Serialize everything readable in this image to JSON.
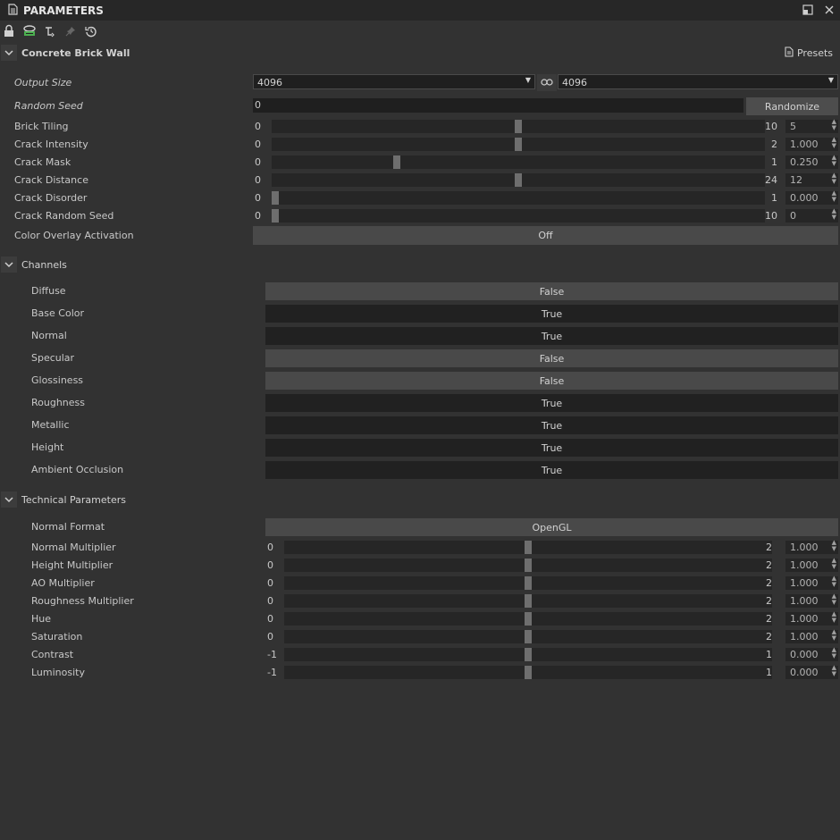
{
  "window": {
    "title": "PARAMETERS",
    "icons": [
      "document-icon",
      "float-window-icon",
      "close-icon"
    ]
  },
  "toolbar": {
    "icons": [
      "lock-icon",
      "refresh-icon",
      "hierarchy-icon",
      "pin-icon",
      "reset-icon"
    ]
  },
  "material": {
    "title": "Concrete Brick Wall",
    "presets_label": "Presets",
    "output_size": {
      "label": "Output Size",
      "width": "4096",
      "height": "4096"
    },
    "random_seed": {
      "label": "Random Seed",
      "value": "0",
      "button": "Randomize"
    },
    "sliders": [
      {
        "label": "Brick Tiling",
        "min": "0",
        "max": "10",
        "value": "5",
        "fraction": 0.5
      },
      {
        "label": "Crack Intensity",
        "min": "0",
        "max": "2",
        "value": "1.000",
        "fraction": 0.5
      },
      {
        "label": "Crack Mask",
        "min": "0",
        "max": "1",
        "value": "0.250",
        "fraction": 0.25
      },
      {
        "label": "Crack Distance",
        "min": "0",
        "max": "24",
        "value": "12",
        "fraction": 0.5
      },
      {
        "label": "Crack Disorder",
        "min": "0",
        "max": "1",
        "value": "0.000",
        "fraction": 0.0
      },
      {
        "label": "Crack Random Seed",
        "min": "0",
        "max": "10",
        "value": "0",
        "fraction": 0.0
      }
    ],
    "color_overlay": {
      "label": "Color Overlay Activation",
      "value": "Off"
    }
  },
  "channels": {
    "title": "Channels",
    "items": [
      {
        "label": "Diffuse",
        "value": "False"
      },
      {
        "label": "Base Color",
        "value": "True"
      },
      {
        "label": "Normal",
        "value": "True"
      },
      {
        "label": "Specular",
        "value": "False"
      },
      {
        "label": "Glossiness",
        "value": "False"
      },
      {
        "label": "Roughness",
        "value": "True"
      },
      {
        "label": "Metallic",
        "value": "True"
      },
      {
        "label": "Height",
        "value": "True"
      },
      {
        "label": "Ambient Occlusion",
        "value": "True"
      }
    ]
  },
  "technical": {
    "title": "Technical Parameters",
    "normal_format": {
      "label": "Normal Format",
      "value": "OpenGL"
    },
    "sliders": [
      {
        "label": "Normal Multiplier",
        "min": "0",
        "max": "2",
        "value": "1.000",
        "fraction": 0.5
      },
      {
        "label": "Height Multiplier",
        "min": "0",
        "max": "2",
        "value": "1.000",
        "fraction": 0.5
      },
      {
        "label": "AO Multiplier",
        "min": "0",
        "max": "2",
        "value": "1.000",
        "fraction": 0.5
      },
      {
        "label": "Roughness Multiplier",
        "min": "0",
        "max": "2",
        "value": "1.000",
        "fraction": 0.5
      },
      {
        "label": "Hue",
        "min": "0",
        "max": "2",
        "value": "1.000",
        "fraction": 0.5
      },
      {
        "label": "Saturation",
        "min": "0",
        "max": "2",
        "value": "1.000",
        "fraction": 0.5
      },
      {
        "label": "Contrast",
        "min": "-1",
        "max": "1",
        "value": "0.000",
        "fraction": 0.5
      },
      {
        "label": "Luminosity",
        "min": "-1",
        "max": "1",
        "value": "0.000",
        "fraction": 0.5
      }
    ]
  }
}
